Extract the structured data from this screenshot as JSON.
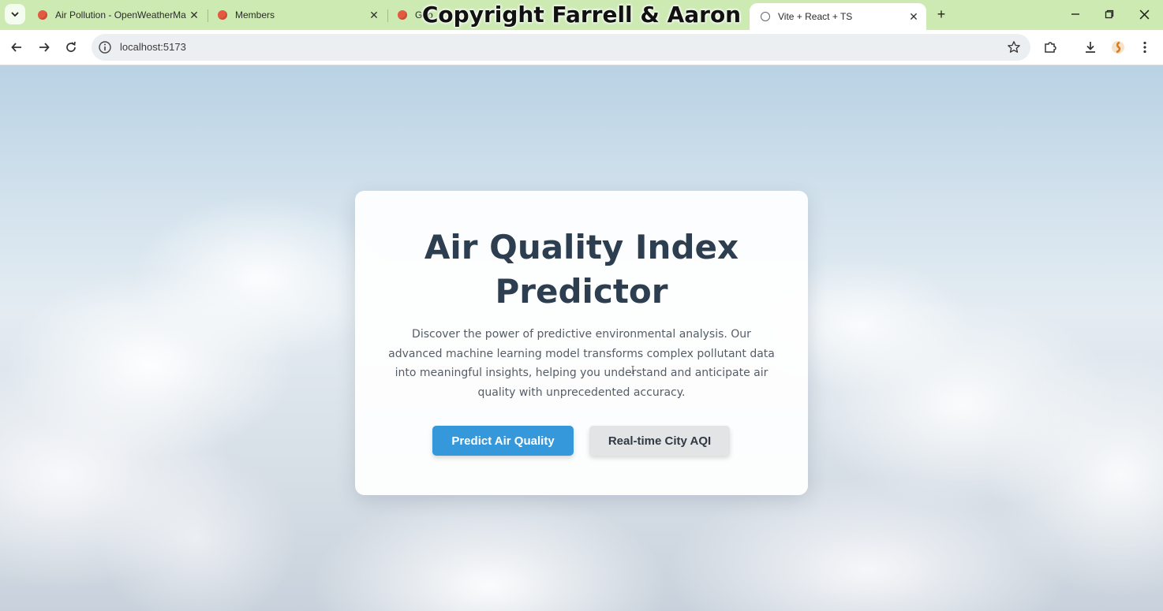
{
  "browser": {
    "tabs": [
      {
        "title": "Air Pollution - OpenWeatherMa",
        "icon": "tab-favicon",
        "active": false
      },
      {
        "title": "Members",
        "icon": "tab-favicon",
        "active": false
      },
      {
        "title": "Geo",
        "icon": "tab-favicon",
        "active": false
      },
      {
        "title": "Vite + React + TS",
        "icon": "globe-icon",
        "active": true
      }
    ],
    "url": "localhost:5173",
    "watermark": "Copyright Farrell & Aaron",
    "colors": {
      "tabstrip": "#cdeab3",
      "omnibox": "#eceff1"
    }
  },
  "hero": {
    "title": "Air Quality Index Predictor",
    "description": "Discover the power of predictive environmental analysis. Our advanced machine learning model transforms complex pollutant data into meaningful insights, helping you understand and anticipate air quality with unprecedented accuracy.",
    "primary_button": "Predict Air Quality",
    "secondary_button": "Real-time City AQI",
    "colors": {
      "title": "#2c3e50",
      "primary": "#3498db",
      "secondary": "#e3e4e6"
    }
  }
}
